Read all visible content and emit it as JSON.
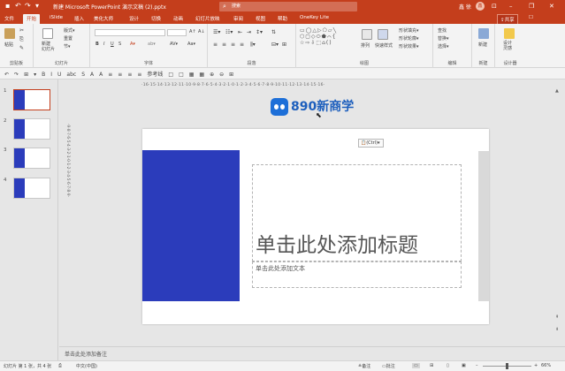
{
  "titlebar": {
    "doc_title": "新建 Microsoft PowerPoint 演示文稿 (2).pptx",
    "search_placeholder": "搜索",
    "user": "鑫 徐",
    "avatar": "鑫",
    "minimize": "–",
    "restore": "❐",
    "close": "✕",
    "ribbon_opts": "⊡",
    "qa_save": "▪",
    "qa_undo": "↶",
    "qa_redo": "↷",
    "qa_more": "▾"
  },
  "tabs": [
    "文件",
    "开始",
    "iSlide",
    "插入",
    "美化大师",
    "设计",
    "切换",
    "动画",
    "幻灯片放映",
    "审阅",
    "视图",
    "帮助",
    "OneKey Lite"
  ],
  "active_tab": "开始",
  "share_label": "⇪共享",
  "comment_label": "☐",
  "ribbon": {
    "clipboard": {
      "paste": "粘贴",
      "label": "剪贴板"
    },
    "slides": {
      "new_slide": "新建\n幻灯片",
      "layout": "版式▾",
      "reset": "重置",
      "section": "节▾",
      "label": "幻灯片"
    },
    "font": {
      "font_name": "",
      "font_size": "",
      "bold": "B",
      "italic": "I",
      "underline": "U",
      "strike": "S",
      "label": "字体"
    },
    "paragraph": {
      "label": "段落"
    },
    "drawing": {
      "arrange": "排列",
      "quick_styles": "快速样式",
      "shape_fill": "形状填充▾",
      "shape_outline": "形状轮廓▾",
      "shape_effects": "形状效果▾",
      "label": "绘图"
    },
    "editing": {
      "find": "查找",
      "replace": "替换▾",
      "select": "选择▾",
      "label": "编辑"
    },
    "new": {
      "label": "新建",
      "btn": "新建"
    },
    "designer": {
      "label": "设计器",
      "btn": "设计\n灵感"
    }
  },
  "quick_toolbar": [
    "↶",
    "↷",
    "⊞",
    "▾",
    "B",
    "I",
    "U",
    "abc",
    "S",
    "A",
    "A",
    "≡",
    "≡",
    "≡",
    "≡",
    "参考线",
    "□",
    "□",
    "▦",
    "▦",
    "⊕",
    "⊖",
    "⊞"
  ],
  "ruler_top": "·16·15·14·13·12·11·10·9·8·7·6·5·4·3·2·1·0·1·2·3·4·5·6·7·8·9·10·11·12·13·14·15·16·",
  "ruler_left": "·9·8·7·6·5·4·3·2·1·0·1·2·3·4·5·6·7·8·9·",
  "thumbnails": [
    {
      "num": "1"
    },
    {
      "num": "2"
    },
    {
      "num": "3"
    },
    {
      "num": "4"
    }
  ],
  "logo": {
    "text": "890新商学"
  },
  "slide": {
    "paste_tag": "📋(Ctrl)▾",
    "title_placeholder": "单击此处添加标题",
    "subtitle_placeholder": "单击此处添加文本"
  },
  "notes_placeholder": "单击此处添加备注",
  "statusbar": {
    "slide_info": "幻灯片 第 1 张，共 4 张",
    "language": "中文(中国)",
    "notes": "≜备注",
    "comments": "▭批注",
    "zoom_minus": "–",
    "zoom_plus": "+",
    "zoom_level": "66%"
  },
  "colors": {
    "accent": "#c43e1c",
    "slide_blue": "#2b3cbb"
  }
}
